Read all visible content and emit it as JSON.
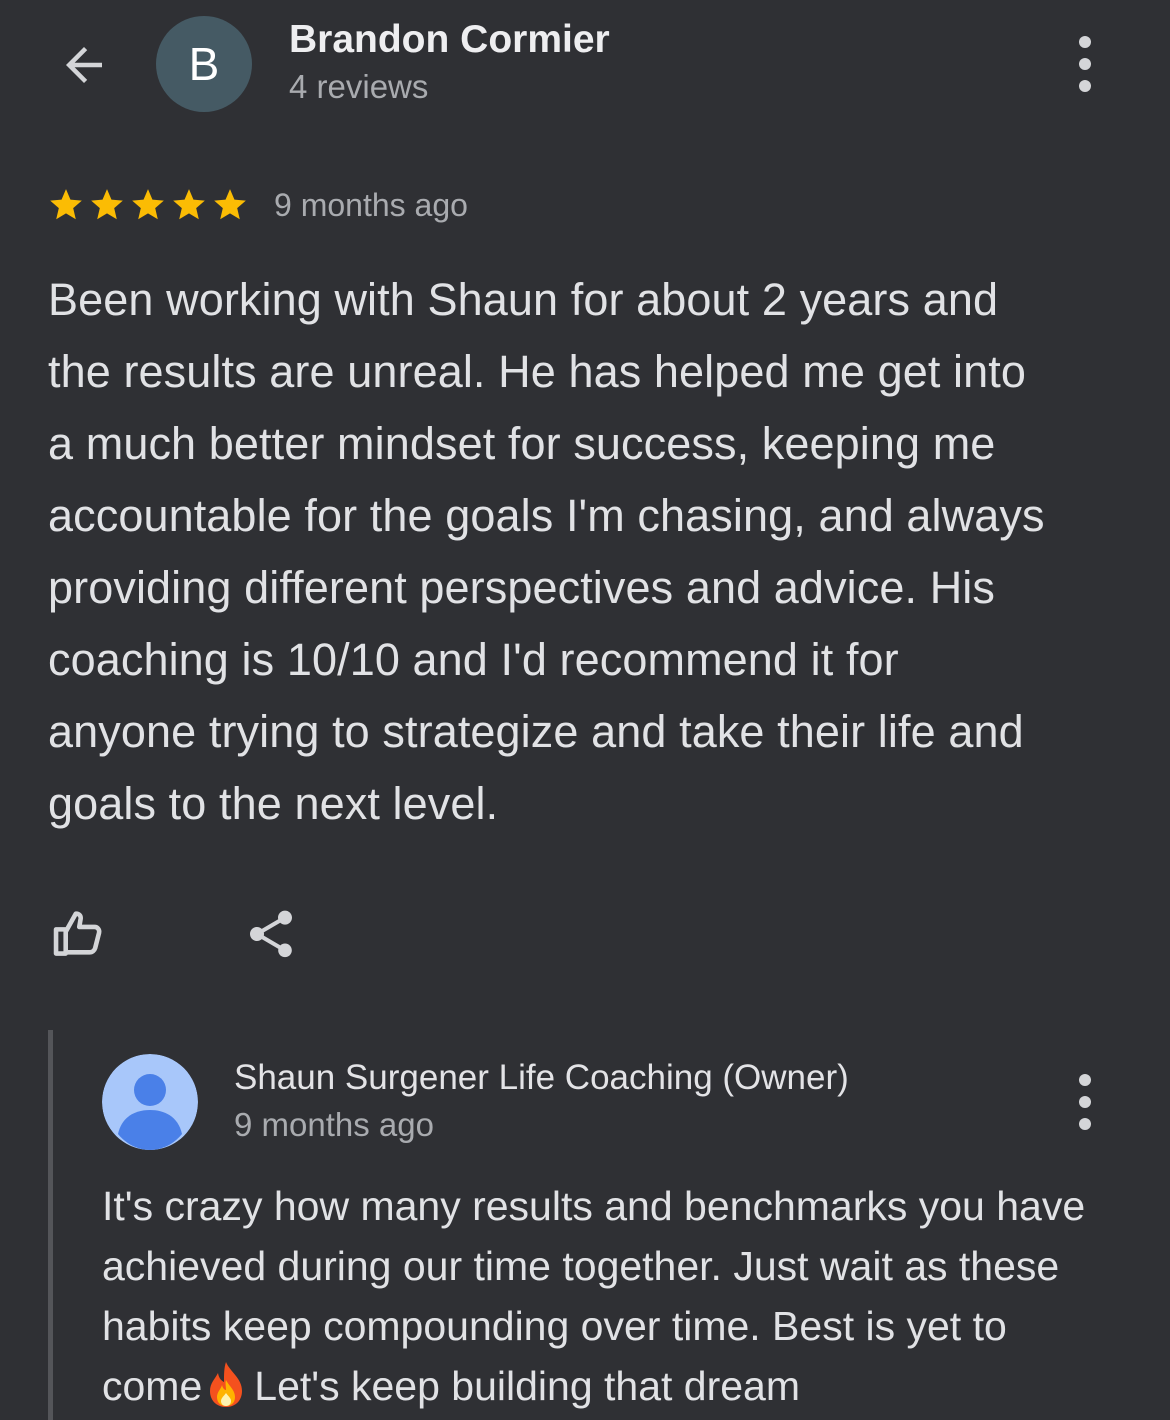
{
  "header": {
    "avatar_letter": "B",
    "reviewer_name": "Brandon Cormier",
    "review_count": "4 reviews",
    "avatar_color": "#455a64"
  },
  "review": {
    "rating": 5,
    "rating_max": 5,
    "star_color": "#fbbc04",
    "time": "9 months ago",
    "lines": [
      "Been working with Shaun for about 2 years and",
      "the results are unreal. He has helped me get into",
      "a much better mindset for success, keeping me",
      "accountable for the goals I'm chasing, and always",
      "providing different perspectives and advice. His",
      "coaching is 10/10 and I'd recommend it for",
      "anyone trying to strategize and take their life and",
      "goals to the next level."
    ]
  },
  "actions": {
    "like_icon": "thumbs-up-icon",
    "share_icon": "share-icon"
  },
  "owner_reply": {
    "name": "Shaun Surgener Life Coaching (Owner)",
    "time": "9 months ago",
    "avatar_color": "#a8c7fa",
    "line_1": "It's crazy how many results and benchmarks you have",
    "line_2": "achieved during our time together. Just wait as these",
    "line_3": "habits keep compounding over time. Best is yet to",
    "line_4_before_emoji": "come",
    "emoji": "fire-emoji",
    "line_4_after_emoji": "Let's keep building that dream"
  }
}
